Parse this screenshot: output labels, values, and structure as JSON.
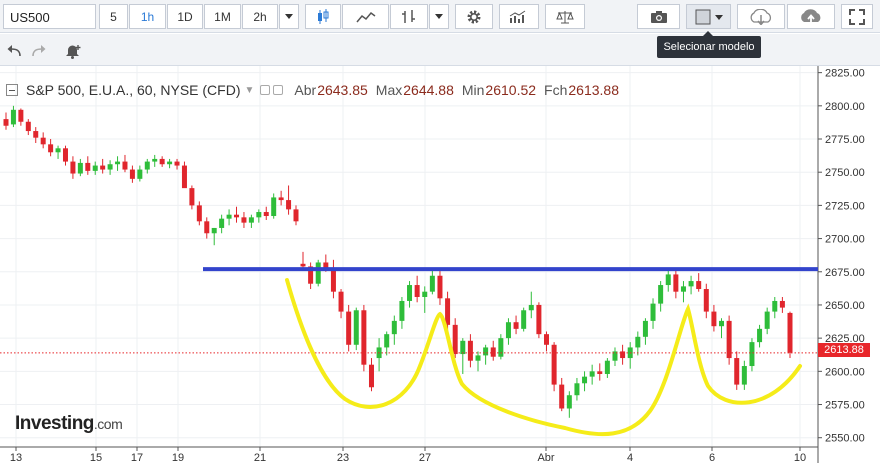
{
  "toolbar": {
    "symbol": "US500",
    "intervals": [
      "5",
      "1h",
      "1D",
      "1M",
      "2h"
    ],
    "active_interval": "1h"
  },
  "tooltip": "Selecionar modelo",
  "legend": {
    "title": "S&P 500, E.U.A., 60, NYSE (CFD)",
    "open_label": "Abr",
    "open": "2643.85",
    "high_label": "Max",
    "high": "2644.88",
    "low_label": "Min",
    "low": "2610.52",
    "close_label": "Fch",
    "close": "2613.88"
  },
  "current_price": "2613.88",
  "logo": {
    "brand": "Investing",
    "domain": ".com"
  },
  "colors": {
    "up": "#2ebd3a",
    "down": "#e0262d",
    "trendline": "#3344cc",
    "annotation": "#f5ec19",
    "price_line": "#e8262a"
  },
  "chart_data": {
    "type": "candlestick",
    "ylim": [
      2543,
      2830
    ],
    "y_ticks": [
      "2825.00",
      "2800.00",
      "2775.00",
      "2750.00",
      "2725.00",
      "2700.00",
      "2675.00",
      "2650.00",
      "2625.00",
      "2600.00",
      "2575.00",
      "2550.00"
    ],
    "x_ticks": [
      "13",
      "15",
      "17",
      "19",
      "21",
      "23",
      "27",
      "Abr",
      "4",
      "6",
      "10"
    ],
    "trendline_value": 2677,
    "current_value": 2613.88,
    "candles": [
      [
        2790,
        2795,
        2782,
        2785
      ],
      [
        2786,
        2800,
        2784,
        2797
      ],
      [
        2797,
        2798,
        2785,
        2788
      ],
      [
        2788,
        2790,
        2778,
        2781
      ],
      [
        2781,
        2784,
        2772,
        2776
      ],
      [
        2776,
        2780,
        2768,
        2771
      ],
      [
        2771,
        2775,
        2762,
        2765
      ],
      [
        2765,
        2770,
        2760,
        2768
      ],
      [
        2768,
        2770,
        2755,
        2758
      ],
      [
        2758,
        2762,
        2745,
        2749
      ],
      [
        2749,
        2760,
        2747,
        2757
      ],
      [
        2757,
        2762,
        2748,
        2751
      ],
      [
        2751,
        2758,
        2748,
        2755
      ],
      [
        2755,
        2760,
        2749,
        2752
      ],
      [
        2752,
        2759,
        2748,
        2756
      ],
      [
        2756,
        2762,
        2751,
        2758
      ],
      [
        2758,
        2763,
        2750,
        2752
      ],
      [
        2752,
        2755,
        2742,
        2745
      ],
      [
        2745,
        2755,
        2743,
        2752
      ],
      [
        2752,
        2760,
        2749,
        2758
      ],
      [
        2758,
        2763,
        2754,
        2760
      ],
      [
        2760,
        2762,
        2754,
        2756
      ],
      [
        2756,
        2760,
        2753,
        2758
      ],
      [
        2758,
        2760,
        2752,
        2755
      ],
      [
        2755,
        2758,
        2745,
        2738
      ],
      [
        2738,
        2740,
        2722,
        2725
      ],
      [
        2725,
        2728,
        2710,
        2713
      ],
      [
        2713,
        2716,
        2700,
        2704
      ],
      [
        2704,
        2708,
        2695,
        2708
      ],
      [
        2708,
        2718,
        2704,
        2715
      ],
      [
        2715,
        2722,
        2710,
        2718
      ],
      [
        2718,
        2724,
        2712,
        2716
      ],
      [
        2716,
        2720,
        2708,
        2712
      ],
      [
        2712,
        2718,
        2708,
        2716
      ],
      [
        2716,
        2722,
        2712,
        2720
      ],
      [
        2720,
        2724,
        2714,
        2717
      ],
      [
        2717,
        2734,
        2715,
        2731
      ],
      [
        2731,
        2736,
        2725,
        2729
      ],
      [
        2729,
        2740,
        2718,
        2722
      ],
      [
        2722,
        2725,
        2710,
        2713
      ],
      [
        2681,
        2690,
        2676,
        2679
      ],
      [
        2679,
        2682,
        2662,
        2666
      ],
      [
        2666,
        2684,
        2664,
        2682
      ],
      [
        2682,
        2688,
        2675,
        2678
      ],
      [
        2678,
        2684,
        2655,
        2660
      ],
      [
        2660,
        2662,
        2640,
        2645
      ],
      [
        2645,
        2650,
        2615,
        2620
      ],
      [
        2620,
        2648,
        2616,
        2646
      ],
      [
        2646,
        2650,
        2600,
        2605
      ],
      [
        2605,
        2610,
        2585,
        2588
      ],
      [
        2610,
        2625,
        2600,
        2618
      ],
      [
        2618,
        2630,
        2612,
        2628
      ],
      [
        2628,
        2642,
        2620,
        2638
      ],
      [
        2638,
        2656,
        2632,
        2653
      ],
      [
        2653,
        2668,
        2648,
        2665
      ],
      [
        2665,
        2672,
        2652,
        2656
      ],
      [
        2656,
        2664,
        2644,
        2660
      ],
      [
        2660,
        2676,
        2658,
        2672
      ],
      [
        2672,
        2676,
        2650,
        2655
      ],
      [
        2655,
        2660,
        2630,
        2635
      ],
      [
        2635,
        2640,
        2610,
        2613
      ],
      [
        2613,
        2625,
        2598,
        2623
      ],
      [
        2623,
        2628,
        2603,
        2608
      ],
      [
        2608,
        2615,
        2600,
        2612
      ],
      [
        2612,
        2620,
        2605,
        2618
      ],
      [
        2618,
        2623,
        2608,
        2611
      ],
      [
        2611,
        2628,
        2609,
        2625
      ],
      [
        2625,
        2640,
        2620,
        2637
      ],
      [
        2637,
        2642,
        2628,
        2632
      ],
      [
        2632,
        2648,
        2630,
        2646
      ],
      [
        2646,
        2660,
        2640,
        2650
      ],
      [
        2650,
        2652,
        2625,
        2628
      ],
      [
        2628,
        2630,
        2615,
        2620
      ],
      [
        2620,
        2622,
        2585,
        2590
      ],
      [
        2590,
        2595,
        2570,
        2572
      ],
      [
        2572,
        2585,
        2565,
        2582
      ],
      [
        2582,
        2595,
        2578,
        2591
      ],
      [
        2591,
        2600,
        2585,
        2596
      ],
      [
        2596,
        2605,
        2590,
        2600
      ],
      [
        2600,
        2606,
        2593,
        2598
      ],
      [
        2598,
        2610,
        2595,
        2608
      ],
      [
        2608,
        2618,
        2604,
        2615
      ],
      [
        2615,
        2620,
        2605,
        2610
      ],
      [
        2610,
        2622,
        2602,
        2618
      ],
      [
        2618,
        2630,
        2612,
        2626
      ],
      [
        2626,
        2640,
        2620,
        2638
      ],
      [
        2638,
        2655,
        2632,
        2651
      ],
      [
        2651,
        2668,
        2645,
        2665
      ],
      [
        2665,
        2676,
        2660,
        2673
      ],
      [
        2673,
        2678,
        2655,
        2660
      ],
      [
        2660,
        2668,
        2652,
        2664
      ],
      [
        2664,
        2672,
        2658,
        2668
      ],
      [
        2668,
        2674,
        2660,
        2662
      ],
      [
        2662,
        2666,
        2640,
        2645
      ],
      [
        2645,
        2650,
        2630,
        2634
      ],
      [
        2634,
        2640,
        2625,
        2638
      ],
      [
        2638,
        2642,
        2605,
        2610
      ],
      [
        2610,
        2615,
        2586,
        2590
      ],
      [
        2590,
        2608,
        2586,
        2604
      ],
      [
        2604,
        2625,
        2600,
        2622
      ],
      [
        2622,
        2635,
        2618,
        2632
      ],
      [
        2632,
        2648,
        2628,
        2645
      ],
      [
        2645,
        2656,
        2640,
        2653
      ],
      [
        2653,
        2656,
        2644,
        2648
      ],
      [
        2644,
        2645,
        2610,
        2614
      ]
    ]
  }
}
